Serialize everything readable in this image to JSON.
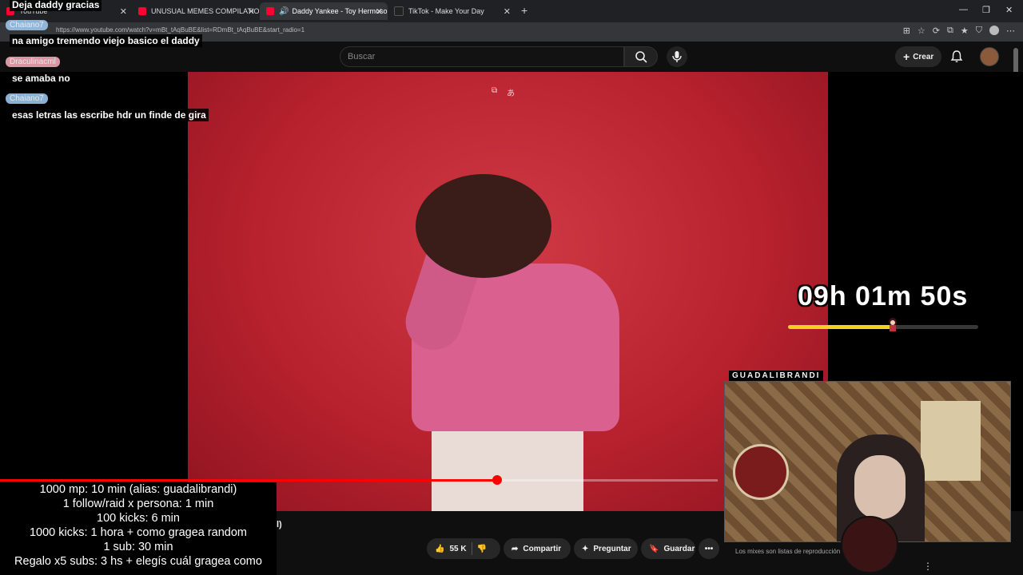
{
  "browser": {
    "tabs": [
      {
        "label": "YouTube",
        "favicon_color": "#ff0033",
        "active": false
      },
      {
        "label": "UNUSUAL MEMES COMPILATION",
        "favicon_color": "#ff0033",
        "active": false
      },
      {
        "label": "Daddy Yankee - Toy Hermoso",
        "favicon_color": "#ff0033",
        "active": true
      },
      {
        "label": "TikTok - Make Your Day",
        "favicon_color": "#222222",
        "active": false
      }
    ],
    "new_tab": "+",
    "url": "https://www.youtube.com/watch?v=mBt_tAqBuBE&list=RDmBt_tAqBuBE&start_radio=1"
  },
  "youtube": {
    "search_placeholder": "Buscar",
    "create_label": "Crear",
    "likes": "55 K",
    "share_label": "Compartir",
    "ask_label": "Preguntar",
    "save_label": "Guardar",
    "title_fragment": "l)",
    "playback_progress": 0.693,
    "sidebar_note": "Los mixes son listas de reproducción ... a par..."
  },
  "chat": [
    {
      "name": "",
      "message": "Deja daddy gracias"
    },
    {
      "name": "Chaiano7",
      "message": "na amigo tremendo viejo basico el daddy"
    },
    {
      "name": "Draculinacml",
      "message": "se amaba no"
    },
    {
      "name": "Chaiano7",
      "message": "esas letras las escribe hdr un finde de gira"
    }
  ],
  "timer": {
    "text": "09h 01m 50s",
    "fill_fraction": 0.55,
    "bar_color": "#f5d020"
  },
  "webcam": {
    "label": "GUADALIBRANDI"
  },
  "goals": [
    "1000 mp: 10 min (alias: guadalibrandi)",
    "1 follow/raid x persona: 1 min",
    "100 kicks: 6 min",
    "1000 kicks: 1 hora + como gragea random",
    "1 sub: 30 min",
    "Regalo x5 subs: 3 hs + elegís cuál gragea como"
  ],
  "colors": {
    "youtube_red": "#ff0000",
    "video_bg": "#b8222e",
    "chat_name_blue": "#9bc4ec",
    "chat_name_pink": "#f2a5b5"
  }
}
